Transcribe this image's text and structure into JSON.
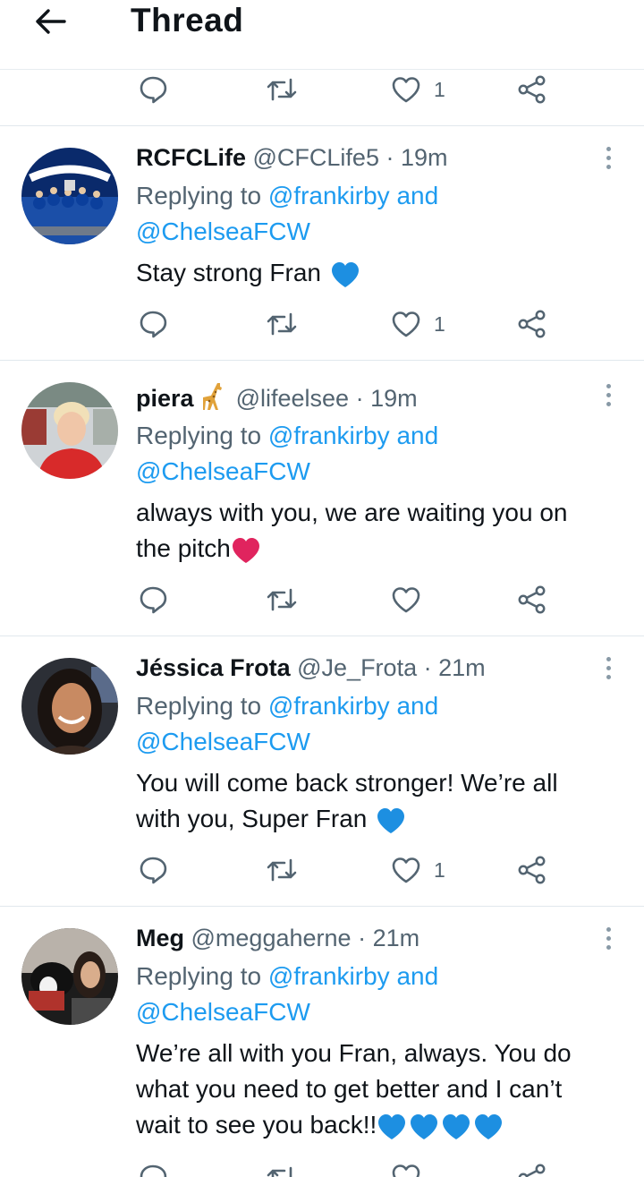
{
  "header": {
    "title": "Thread",
    "back_icon": "arrow-left-icon"
  },
  "colors": {
    "mention": "#1d9bf0",
    "secondary_text": "#536471",
    "divider": "#e1e8ed",
    "heart_red": "#e0245e",
    "blue_heart": "#1d8fe1"
  },
  "top_actions": {
    "like_count": "1"
  },
  "tweets": [
    {
      "name": "RCFCLife",
      "handle": "@CFCLife5",
      "dot": "·",
      "time": "19m",
      "replying_prefix": "Replying to",
      "mention1": "@frankirby",
      "and": "and",
      "mention2": "@ChelseaFCW",
      "text": "Stay strong Fran",
      "like_count": "1"
    },
    {
      "name": "piera",
      "handle": "@lifeelsee",
      "dot": "·",
      "time": "19m",
      "replying_prefix": "Replying to",
      "mention1": "@frankirby",
      "and": "and",
      "mention2": "@ChelseaFCW",
      "text_line1": "always with you, we are waiting you on",
      "text_line2": "the pitch",
      "like_count": ""
    },
    {
      "name": "Jéssica Frota",
      "handle": "@Je_Frota",
      "dot": "·",
      "time": "21m",
      "replying_prefix": "Replying to",
      "mention1": "@frankirby",
      "and": "and",
      "mention2": "@ChelseaFCW",
      "text_line1": "You will come back stronger! We’re all",
      "text_line2": "with you, Super Fran",
      "like_count": "1"
    },
    {
      "name": "Meg",
      "handle": "@meggaherne",
      "dot": "·",
      "time": "21m",
      "replying_prefix": "Replying to",
      "mention1": "@frankirby",
      "and": "and",
      "mention2": "@ChelseaFCW",
      "text_line1": "We’re all with you Fran, always. You do",
      "text_line2": "what you need to get better and I can’t",
      "text_line3": "wait to see you back!!"
    }
  ]
}
